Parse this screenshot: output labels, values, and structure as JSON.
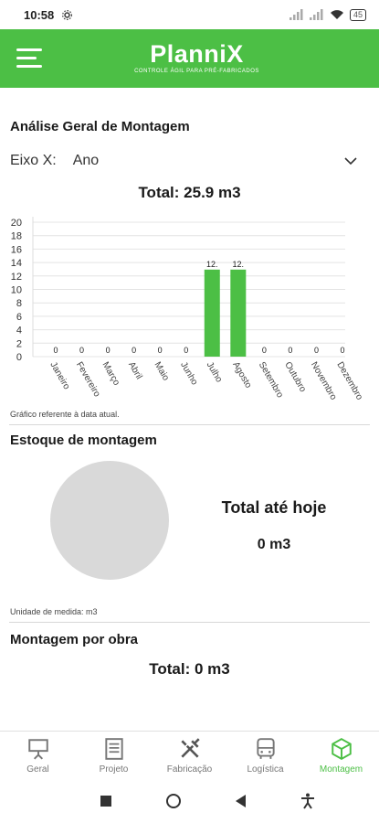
{
  "status": {
    "time": "10:58",
    "battery": "45"
  },
  "header": {
    "brand": "PlanniX",
    "tagline": "CONTROLE ÁGIL PARA PRÉ-FABRICADOS"
  },
  "analysis": {
    "title": "Análise Geral de Montagem",
    "axis_label": "Eixo X:",
    "axis_value": "Ano",
    "total": "Total: 25.9 m3",
    "caption": "Gráfico referente à data atual."
  },
  "chart_data": {
    "type": "bar",
    "categories": [
      "Janeiro",
      "Fevereiro",
      "Março",
      "Abril",
      "Maio",
      "Junho",
      "Julho",
      "Agosto",
      "Setembro",
      "Outubro",
      "Novembro",
      "Dezembro"
    ],
    "values": [
      0,
      0,
      0,
      0,
      0,
      0,
      12.95,
      12.95,
      0,
      0,
      0,
      0
    ],
    "data_labels": [
      "0",
      "0",
      "0",
      "0",
      "0",
      "0",
      "12.",
      "12.",
      "0",
      "0",
      "0",
      "0"
    ],
    "yticks": [
      0,
      2,
      4,
      6,
      8,
      10,
      12,
      14,
      16,
      18,
      20
    ],
    "ylim": [
      0,
      20
    ],
    "bar_color": "#4cbf45",
    "grid": true
  },
  "stock": {
    "title": "Estoque de montagem",
    "total_label": "Total até hoje",
    "total_value": "0 m3",
    "caption": "Unidade de medida: m3"
  },
  "per_work": {
    "title": "Montagem por obra",
    "total": "Total: 0 m3"
  },
  "nav": [
    {
      "label": "Geral",
      "icon": "presentation-board-icon"
    },
    {
      "label": "Projeto",
      "icon": "document-icon"
    },
    {
      "label": "Fabricação",
      "icon": "tools-icon"
    },
    {
      "label": "Logística",
      "icon": "bus-icon"
    },
    {
      "label": "Montagem",
      "icon": "cube-icon",
      "active": true
    }
  ],
  "colors": {
    "primary": "#4cbf45",
    "pie": "#d9d9d9"
  }
}
